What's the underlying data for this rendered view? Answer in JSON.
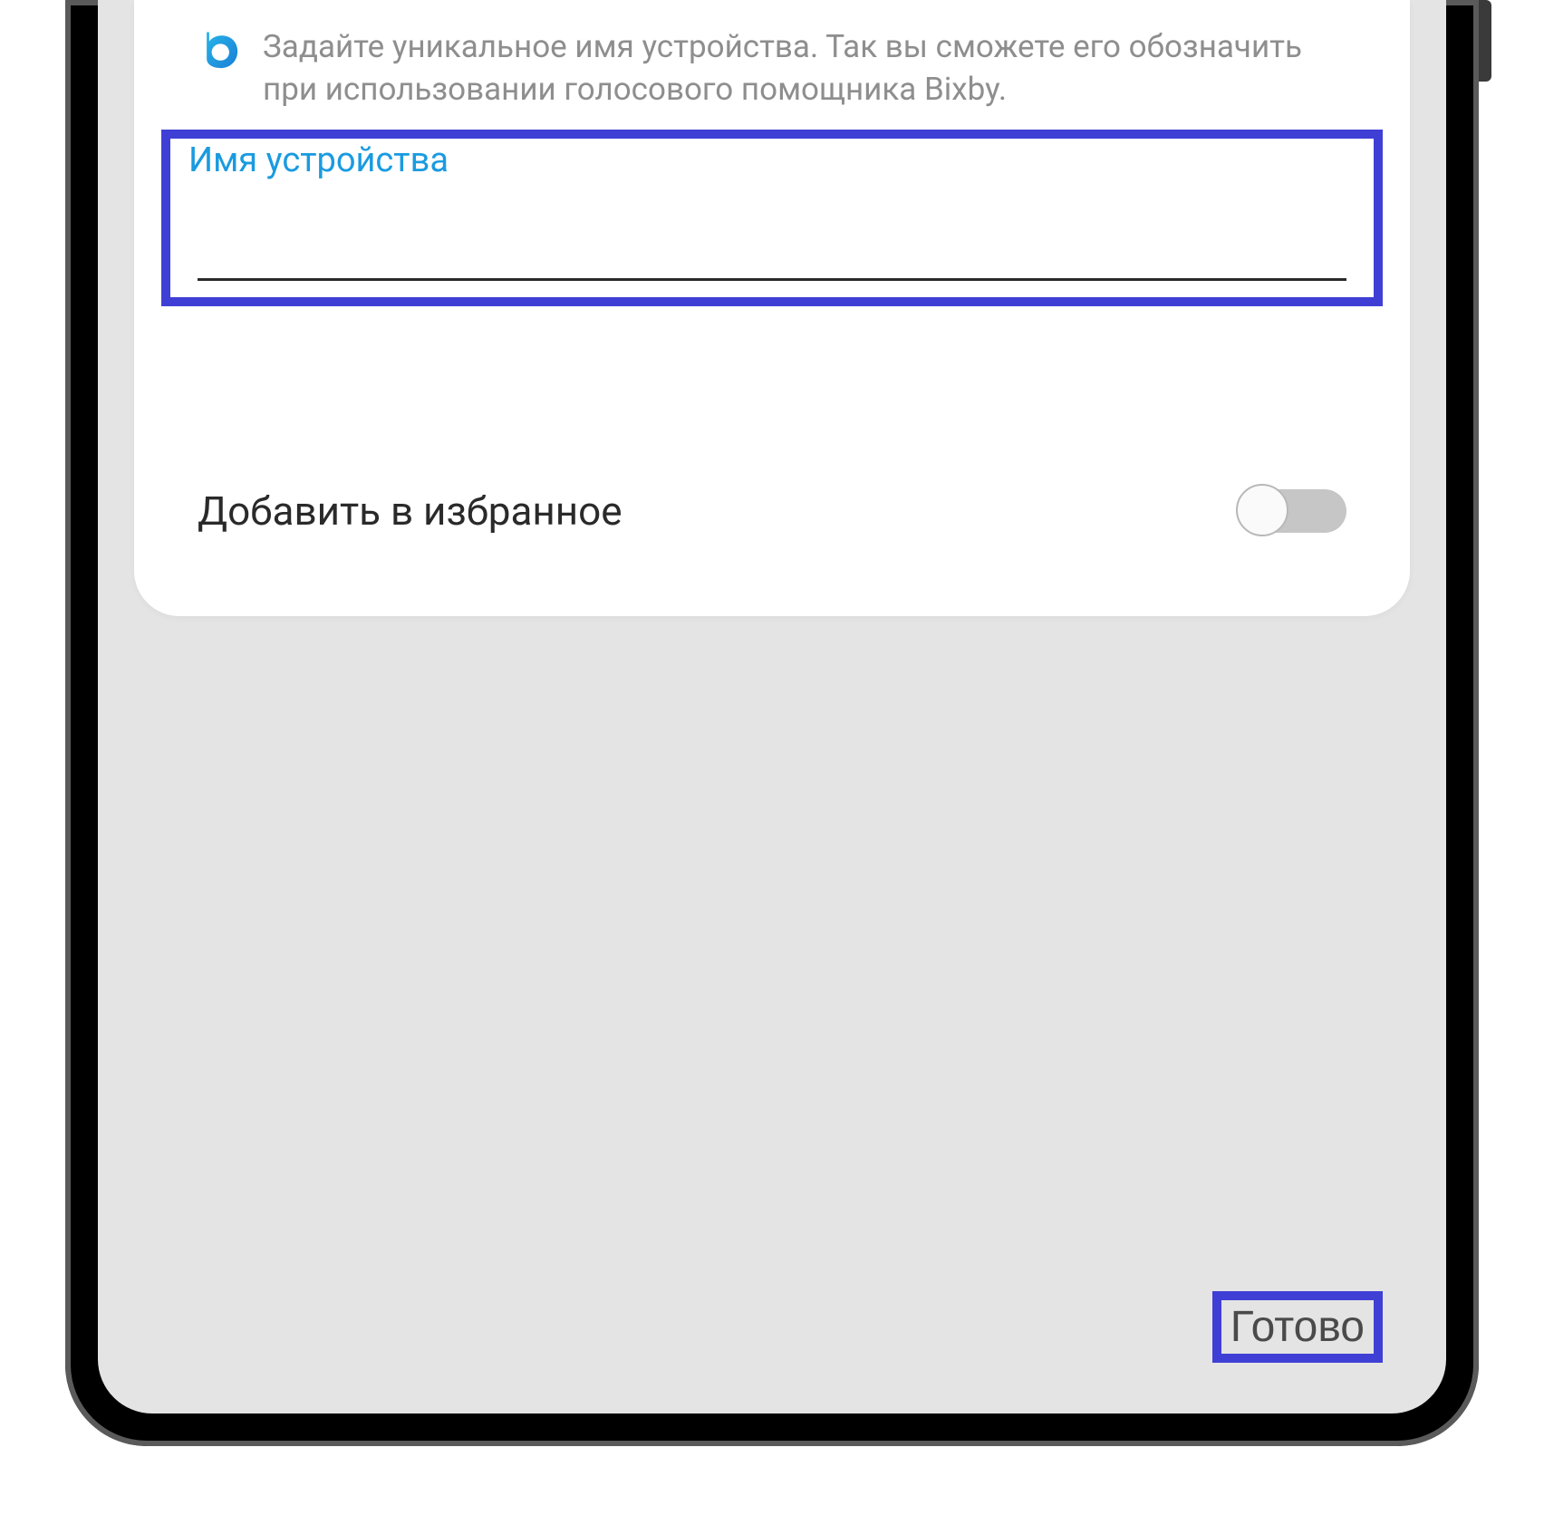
{
  "bixby": {
    "description": "Задайте уникальное имя устройства. Так вы сможете его обозначить при использовании голосового помощника Bixby."
  },
  "device_name": {
    "label": "Имя устройства",
    "value": ""
  },
  "favorite": {
    "label": "Добавить в избранное",
    "enabled": false
  },
  "actions": {
    "done": "Готово"
  },
  "colors": {
    "highlight_border": "#3f3fd6",
    "link": "#1a9be0"
  }
}
